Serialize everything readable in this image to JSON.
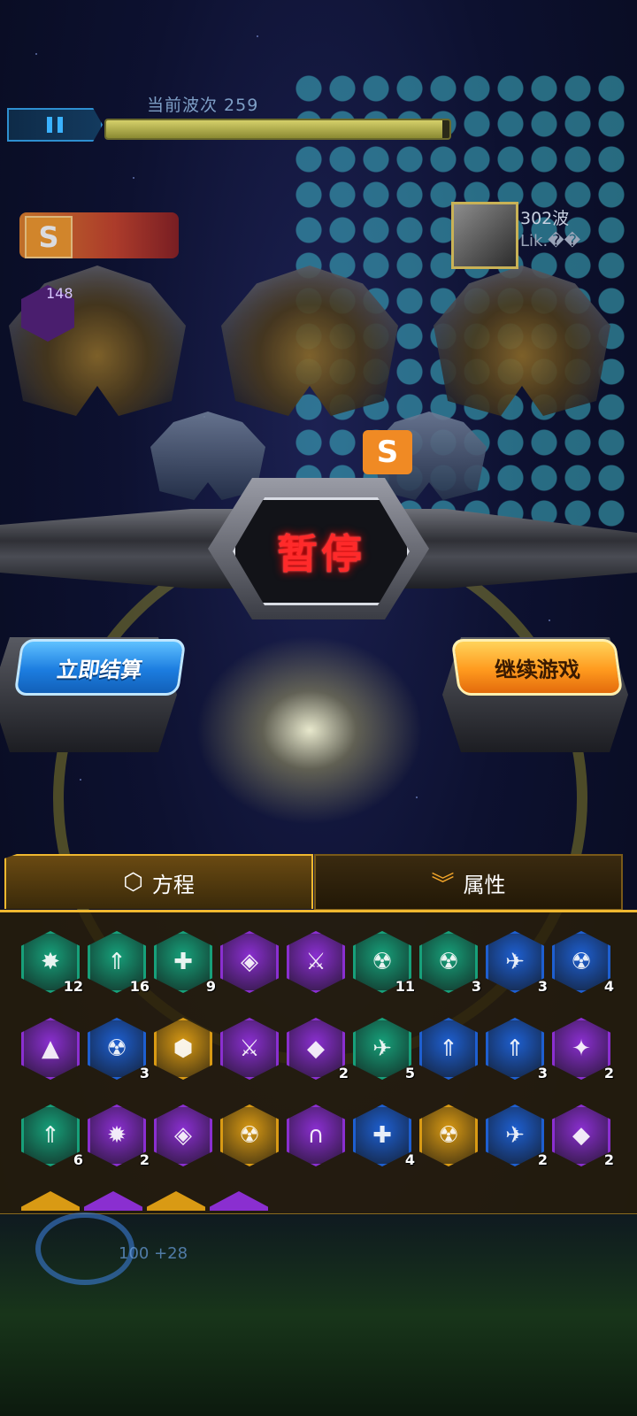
{
  "hud": {
    "wave_label": "当前波次 259",
    "wave_progress": 0.98,
    "pause_icon": "pause-icon",
    "level_badge": "S",
    "side_count": "148",
    "opponent": {
      "wave": "302波",
      "name": "Lik.��"
    },
    "hp_text": "100 +28"
  },
  "pause_banner": {
    "title": "暂停"
  },
  "actions": {
    "settle_label": "立即结算",
    "continue_label": "继续游戏"
  },
  "tabs": [
    {
      "label": "方程",
      "icon": "hex-logo-icon",
      "active": true
    },
    {
      "label": "属性",
      "icon": "double-chevron-down-icon",
      "active": false
    }
  ],
  "skills": [
    {
      "icon": "explosion-ships-icon",
      "color": "#17a07a",
      "count": "12"
    },
    {
      "icon": "fleet-upgrade-icon",
      "color": "#17a07a",
      "count": "16"
    },
    {
      "icon": "cross-plus-icon",
      "color": "#17a07a",
      "count": "9"
    },
    {
      "icon": "crystal-core-icon",
      "color": "#8a2fd0",
      "count": ""
    },
    {
      "icon": "sword-bio-icon",
      "color": "#8a2fd0",
      "count": ""
    },
    {
      "icon": "radiation-icon",
      "color": "#17a07a",
      "count": "11"
    },
    {
      "icon": "radiation-swirl-icon",
      "color": "#17a07a",
      "count": "3"
    },
    {
      "icon": "ship-blast-icon",
      "color": "#1e5fd0",
      "count": "3"
    },
    {
      "icon": "radiation-swirl-icon",
      "color": "#1e5fd0",
      "count": "4"
    },
    {
      "icon": "rocket-up-icon",
      "color": "#8a2fd0",
      "count": ""
    },
    {
      "icon": "radiation-swirl-icon",
      "color": "#1e5fd0",
      "count": "3"
    },
    {
      "icon": "honeycomb-icon",
      "color": "#d99a14",
      "count": ""
    },
    {
      "icon": "bio-sword-icon",
      "color": "#8a2fd0",
      "count": ""
    },
    {
      "icon": "crystal-spark-icon",
      "color": "#8a2fd0",
      "count": "2"
    },
    {
      "icon": "ship-trail-icon",
      "color": "#17a07a",
      "count": "5"
    },
    {
      "icon": "fleet-upgrade-icon",
      "color": "#1e5fd0",
      "count": ""
    },
    {
      "icon": "fleet-upgrade-icon",
      "color": "#1e5fd0",
      "count": "3"
    },
    {
      "icon": "strike-plus-icon",
      "color": "#8a2fd0",
      "count": "2"
    },
    {
      "icon": "fleet-upgrade-icon",
      "color": "#17a07a",
      "count": "6"
    },
    {
      "icon": "blast-upgrade-icon",
      "color": "#8a2fd0",
      "count": "2"
    },
    {
      "icon": "crystal-ship-icon",
      "color": "#8a2fd0",
      "count": ""
    },
    {
      "icon": "radiation-box-icon",
      "color": "#d99a14",
      "count": ""
    },
    {
      "icon": "magnet-crystal-icon",
      "color": "#8a2fd0",
      "count": ""
    },
    {
      "icon": "cross-plus-icon",
      "color": "#1e5fd0",
      "count": "4"
    },
    {
      "icon": "radiation-blast-icon",
      "color": "#d99a14",
      "count": ""
    },
    {
      "icon": "jet-icon",
      "color": "#1e5fd0",
      "count": "2"
    },
    {
      "icon": "crystal-icon",
      "color": "#8a2fd0",
      "count": "2"
    }
  ],
  "partial_skills": [
    {
      "icon": "gold-orb-icon",
      "color": "#d99a14"
    },
    {
      "icon": "purple-ship-icon",
      "color": "#8a2fd0"
    },
    {
      "icon": "gold-ship-icon",
      "color": "#d99a14"
    },
    {
      "icon": "purple-core-icon",
      "color": "#8a2fd0"
    }
  ]
}
